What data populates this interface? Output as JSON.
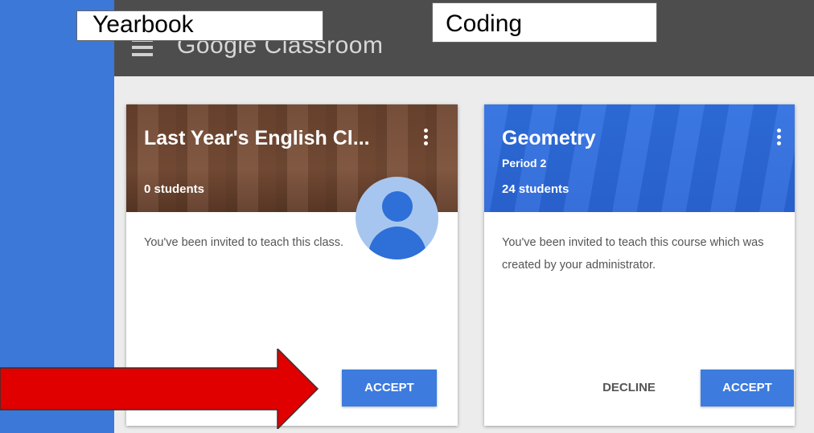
{
  "app": {
    "title": "Google Classroom"
  },
  "overlay_labels": {
    "yearbook": "Yearbook",
    "coding": "Coding"
  },
  "cards": [
    {
      "title": "Last Year's English Cl...",
      "students": "0 students",
      "message": "You've been invited to teach this class.",
      "accept_label": "ACCEPT"
    },
    {
      "title": "Geometry",
      "subtitle": "Period 2",
      "students": "24 students",
      "message": "You've been invited to teach this course which was created by your administrator.",
      "decline_label": "DECLINE",
      "accept_label": "ACCEPT"
    }
  ],
  "icons": [
    "menu-icon",
    "more-vert-icon",
    "avatar-icon",
    "arrow-icon"
  ],
  "colors": {
    "outer_background": "#3c78d8",
    "topbar": "#4d4d4d",
    "accept_button": "#3d7bde",
    "arrow": "#e00000",
    "english_header": "#7a4f37",
    "geometry_header": "#2b66d8"
  }
}
